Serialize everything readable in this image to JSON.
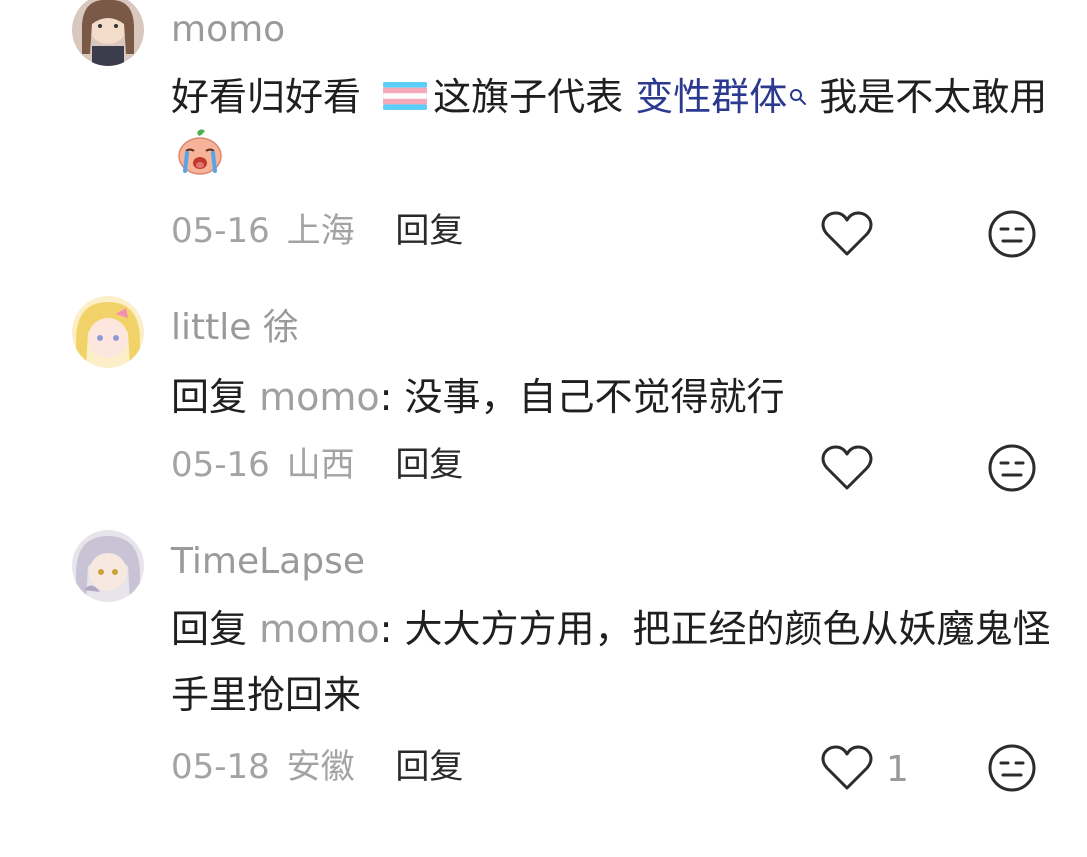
{
  "comments": [
    {
      "username": "momo",
      "text_before_flag": "好看归好看 ",
      "flag_icon": "transgender-flag-icon",
      "text_after_flag": "这旗子代表 ",
      "topic_link": "变性群体",
      "text_after_link": " 我是不太敢用",
      "emoji": "crying-face-emoji",
      "date": "05-16",
      "region": "上海",
      "reply_label": "回复",
      "like_icon": "heart-outline-icon",
      "like_count": "",
      "dislike_icon": "meh-face-icon"
    },
    {
      "username": "little 徐",
      "reply_prefix": "回复",
      "reply_to": "momo",
      "reply_sep": ": ",
      "text": "没事，自己不觉得就行",
      "date": "05-16",
      "region": "山西",
      "reply_label": "回复",
      "like_icon": "heart-outline-icon",
      "like_count": "",
      "dislike_icon": "meh-face-icon"
    },
    {
      "username": "TimeLapse",
      "reply_prefix": "回复",
      "reply_to": "momo",
      "reply_sep": ": ",
      "text": "大大方方用，把正经的颜色从妖魔鬼怪手里抢回来",
      "date": "05-18",
      "region": "安徽",
      "reply_label": "回复",
      "like_icon": "heart-outline-icon",
      "like_count": "1",
      "dislike_icon": "meh-face-icon"
    }
  ],
  "colors": {
    "username": "#9a9a9a",
    "text": "#1f1f1f",
    "meta": "#a3a3a3",
    "topic_link": "#2b3a8f",
    "reply_target": "#a0a0a0",
    "icon_stroke": "#2c2c2c"
  }
}
